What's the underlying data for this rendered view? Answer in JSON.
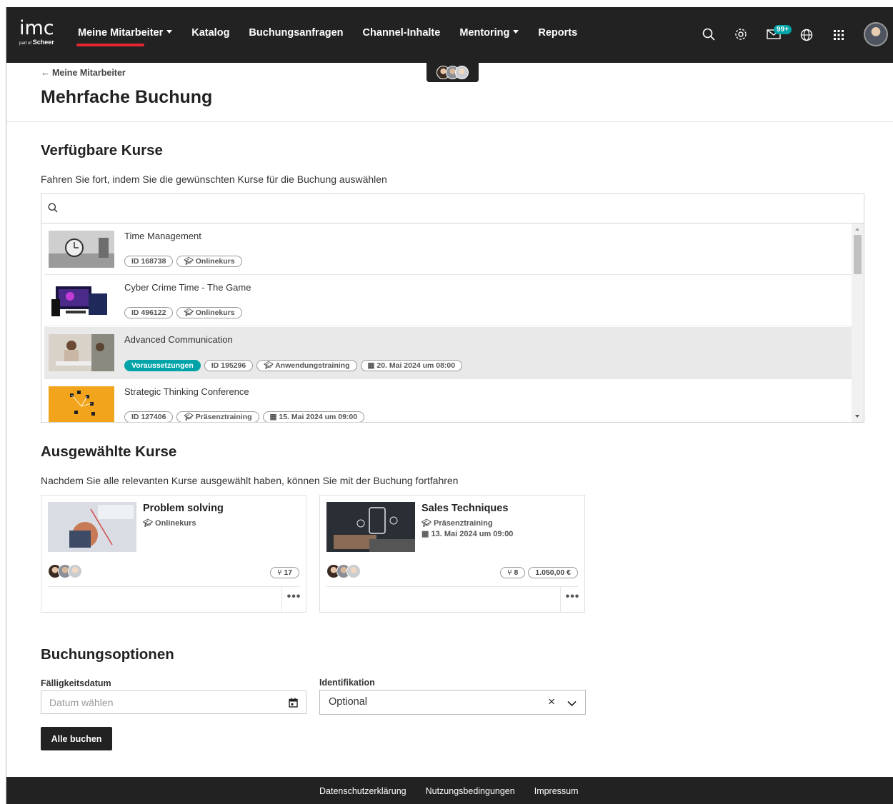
{
  "header": {
    "logo_text": "imc",
    "logo_sub_prefix": "part of",
    "logo_sub_brand": "Scheer",
    "nav": [
      {
        "label": "Meine Mitarbeiter",
        "dropdown": true,
        "active": true
      },
      {
        "label": "Katalog",
        "dropdown": false
      },
      {
        "label": "Buchungsanfragen",
        "dropdown": false
      },
      {
        "label": "Channel-Inhalte",
        "dropdown": false
      },
      {
        "label": "Mentoring",
        "dropdown": true
      },
      {
        "label": "Reports",
        "dropdown": false
      }
    ],
    "icons": [
      "search-icon",
      "gear-icon",
      "mail-icon",
      "globe-icon",
      "apps-grid-icon"
    ],
    "mail_badge": "99+",
    "accent_color": "#e3262f",
    "badge_color": "#00a3a8"
  },
  "breadcrumb": "← Meine Mitarbeiter",
  "page_title": "Mehrfache Buchung",
  "available": {
    "heading": "Verfügbare Kurse",
    "description": "Fahren Sie fort, indem Sie die gewünschten Kurse für die Buchung auswählen",
    "courses": [
      {
        "title": "Time Management",
        "chips": [
          "ID 168738",
          "Onlinekurs"
        ]
      },
      {
        "title": "Cyber Crime Time - The Game",
        "chips": [
          "ID 496122",
          "Onlinekurs"
        ]
      },
      {
        "title": "Advanced Communication",
        "prerequisite": "Voraussetzungen",
        "chips": [
          "ID 195296",
          "Anwendungstraining",
          "20. Mai 2024 um 08:00"
        ]
      },
      {
        "title": "Strategic Thinking Conference",
        "chips": [
          "ID 127406",
          "Präsenztraining",
          "15. Mai 2024 um 09:00"
        ]
      }
    ]
  },
  "selected": {
    "heading": "Ausgewählte Kurse",
    "description": "Nachdem Sie alle relevanten Kurse ausgewählt haben, können Sie mit der Buchung fortfahren",
    "cards": [
      {
        "title": "Problem solving",
        "type": "Onlinekurs",
        "date": "",
        "seats": "17",
        "price": ""
      },
      {
        "title": "Sales Techniques",
        "type": "Präsenztraining",
        "date": "13. Mai 2024 um 09:00",
        "seats": "8",
        "price": "1.050,00 €"
      }
    ],
    "more_label": "•••"
  },
  "options": {
    "heading": "Buchungsoptionen",
    "due_label": "Fälligkeitsdatum",
    "due_placeholder": "Datum wählen",
    "id_label": "Identifikation",
    "id_value": "Optional",
    "book_button": "Alle buchen"
  },
  "footer": {
    "links": [
      "Datenschutzerklärung",
      "Nutzungsbedingungen",
      "Impressum"
    ]
  }
}
